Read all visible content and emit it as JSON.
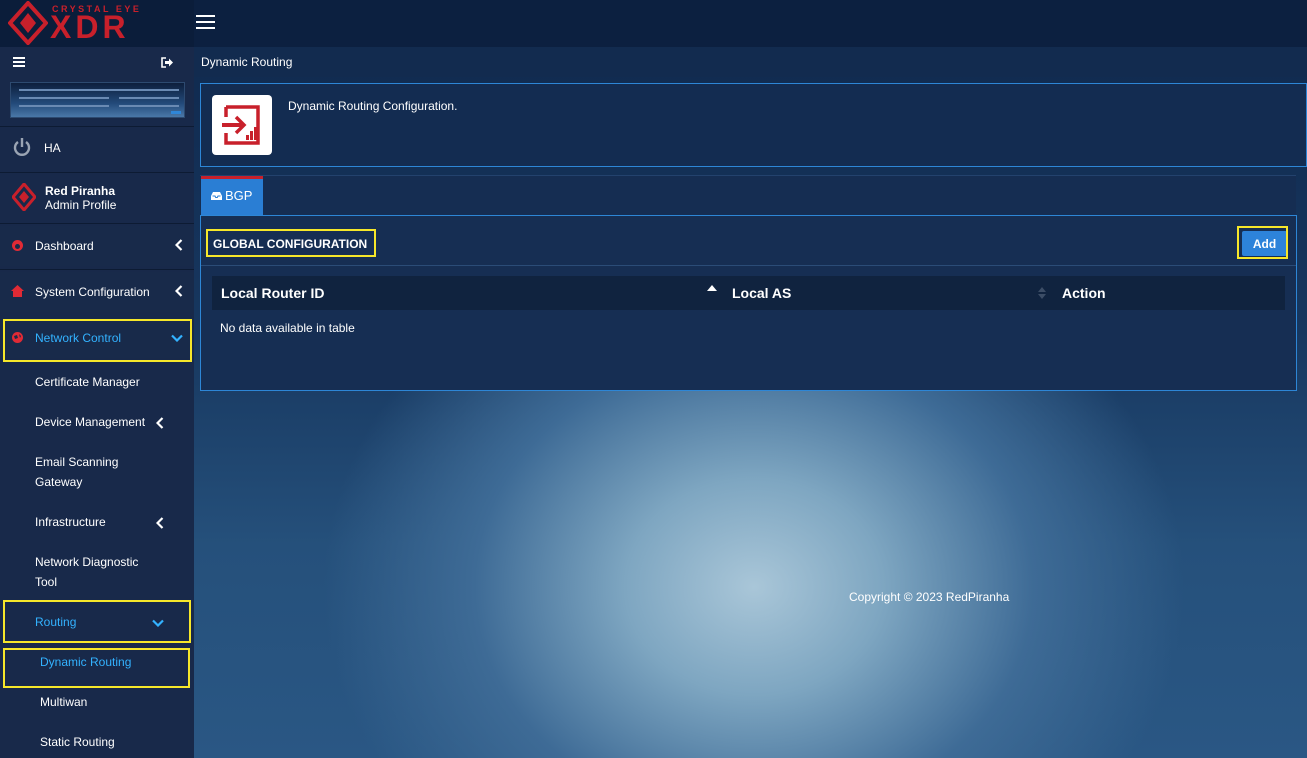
{
  "brand": {
    "tagline": "CRYSTAL EYE",
    "name": "XDR"
  },
  "sidebar": {
    "ha_label": "HA",
    "profile": {
      "name": "Red Piranha",
      "role": "Admin Profile"
    },
    "menu": [
      {
        "label": "Dashboard"
      },
      {
        "label": "System Configuration"
      },
      {
        "label": "Network Control"
      }
    ],
    "network_control_items": [
      {
        "label": "Certificate Manager"
      },
      {
        "label": "Device Management"
      },
      {
        "label": "Email Scanning",
        "label2": "Gateway"
      },
      {
        "label": "Infrastructure"
      },
      {
        "label": "Network Diagnostic",
        "label2": "Tool"
      },
      {
        "label": "Routing"
      }
    ],
    "routing_items": [
      {
        "label": "Dynamic Routing"
      },
      {
        "label": "Multiwan"
      },
      {
        "label": "Static Routing"
      }
    ]
  },
  "breadcrumb": "Dynamic Routing",
  "header": {
    "description": "Dynamic Routing Configuration."
  },
  "tabs": [
    {
      "label": "BGP"
    }
  ],
  "panel": {
    "title": "GLOBAL CONFIGURATION",
    "add_label": "Add",
    "columns": [
      "Local Router ID",
      "Local AS",
      "Action"
    ],
    "empty_text": "No data available in table"
  },
  "footer": {
    "copyright": "Copyright © 2023 RedPiranha"
  },
  "colors": {
    "accent": "#2d83da",
    "brand_red": "#c8202b",
    "highlight": "#f6e72a",
    "active_text": "#33b2ff"
  }
}
